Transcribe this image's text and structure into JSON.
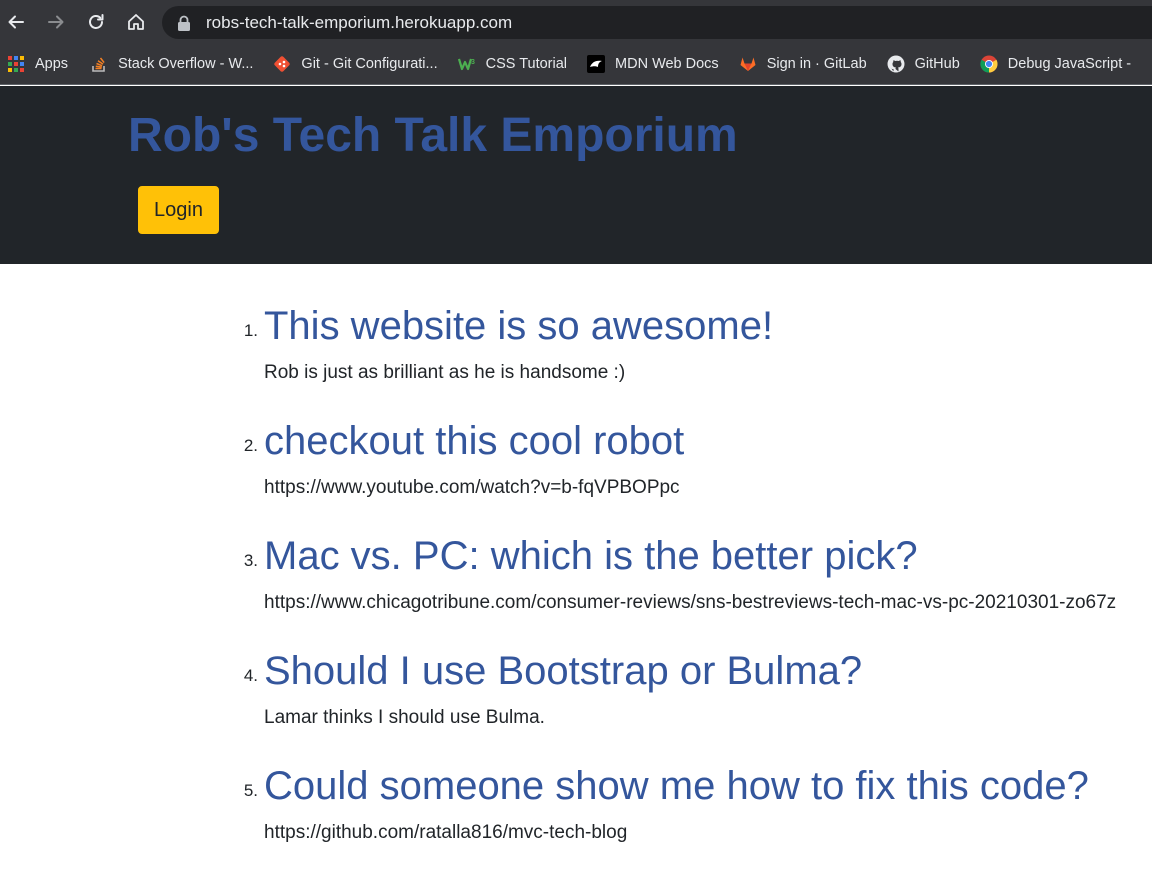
{
  "browser": {
    "url": "robs-tech-talk-emporium.herokuapp.com",
    "bookmarks": [
      {
        "label": "Apps",
        "icon": "apps-grid-icon"
      },
      {
        "label": "Stack Overflow - W...",
        "icon": "stackoverflow-icon"
      },
      {
        "label": "Git - Git Configurati...",
        "icon": "git-icon"
      },
      {
        "label": "CSS Tutorial",
        "icon": "w3schools-icon"
      },
      {
        "label": "MDN Web Docs",
        "icon": "mdn-icon"
      },
      {
        "label": "Sign in · GitLab",
        "icon": "gitlab-icon"
      },
      {
        "label": "GitHub",
        "icon": "github-icon"
      },
      {
        "label": "Debug JavaScript -",
        "icon": "chrome-icon"
      }
    ]
  },
  "header": {
    "title": "Rob's Tech Talk Emporium",
    "login_label": "Login"
  },
  "posts": [
    {
      "num": "1.",
      "title": "This website is so awesome!",
      "body": "Rob is just as brilliant as he is handsome :)"
    },
    {
      "num": "2.",
      "title": "checkout this cool robot",
      "body": "https://www.youtube.com/watch?v=b-fqVPBOPpc"
    },
    {
      "num": "3.",
      "title": "Mac vs. PC: which is the better pick?",
      "body": "https://www.chicagotribune.com/consumer-reviews/sns-bestreviews-tech-mac-vs-pc-20210301-zo67z"
    },
    {
      "num": "4.",
      "title": "Should I use Bootstrap or Bulma?",
      "body": "Lamar thinks I should use Bulma."
    },
    {
      "num": "5.",
      "title": "Could someone show me how to fix this code?",
      "body": "https://github.com/ratalla816/mvc-tech-blog"
    }
  ],
  "colors": {
    "header_bg": "#212529",
    "title_blue": "#34569c",
    "login_yellow": "#ffc107",
    "chrome_bg": "#35363a"
  }
}
